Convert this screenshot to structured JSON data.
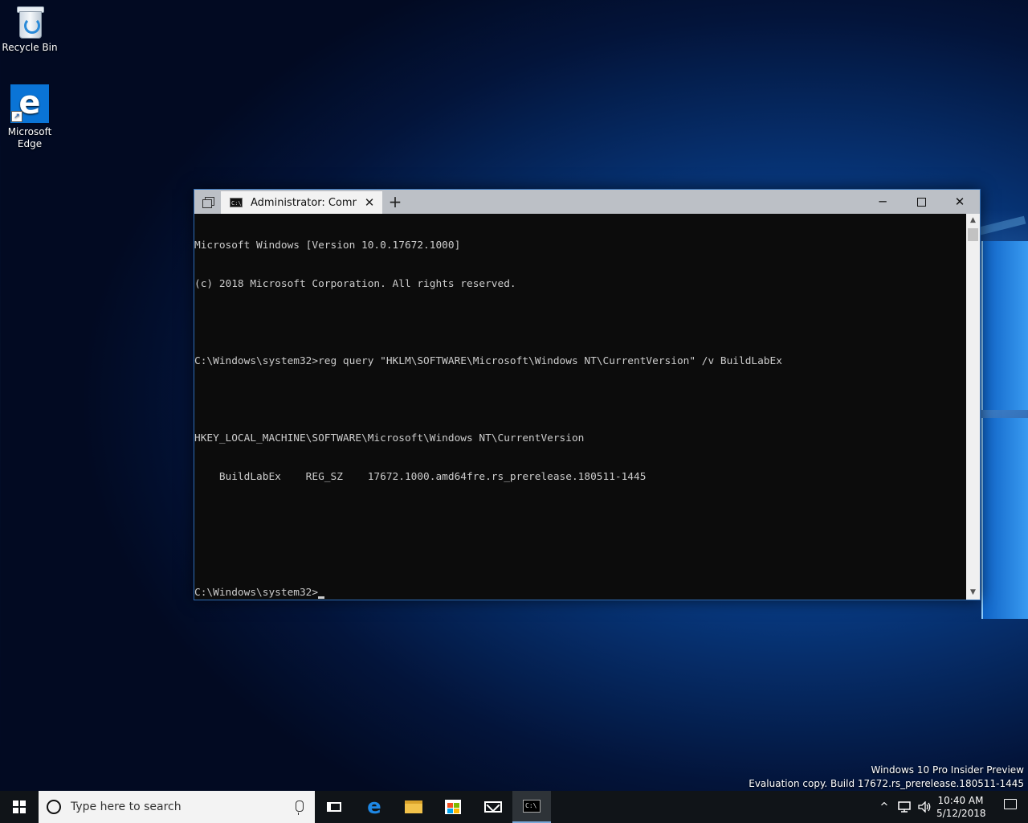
{
  "desktop": {
    "icons": [
      {
        "label": "Recycle Bin",
        "icon": "recycle-bin-icon"
      },
      {
        "label": "Microsoft\nEdge",
        "icon": "edge-icon"
      }
    ]
  },
  "window": {
    "tab_title": "Administrator: Comma",
    "tab_close": "✕",
    "new_tab": "+",
    "minimize": "─",
    "close": "✕"
  },
  "console": {
    "lines": [
      "Microsoft Windows [Version 10.0.17672.1000]",
      "(c) 2018 Microsoft Corporation. All rights reserved.",
      "",
      "C:\\Windows\\system32>reg query \"HKLM\\SOFTWARE\\Microsoft\\Windows NT\\CurrentVersion\" /v BuildLabEx",
      "",
      "HKEY_LOCAL_MACHINE\\SOFTWARE\\Microsoft\\Windows NT\\CurrentVersion",
      "    BuildLabEx    REG_SZ    17672.1000.amd64fre.rs_prerelease.180511-1445",
      "",
      ""
    ],
    "prompt": "C:\\Windows\\system32>"
  },
  "watermark": {
    "line1": "Windows 10 Pro Insider Preview",
    "line2": "Evaluation copy. Build 17672.rs_prerelease.180511-1445"
  },
  "taskbar": {
    "search_placeholder": "Type here to search",
    "chevron": "^",
    "time": "10:40 AM",
    "date": "5/12/2018"
  }
}
